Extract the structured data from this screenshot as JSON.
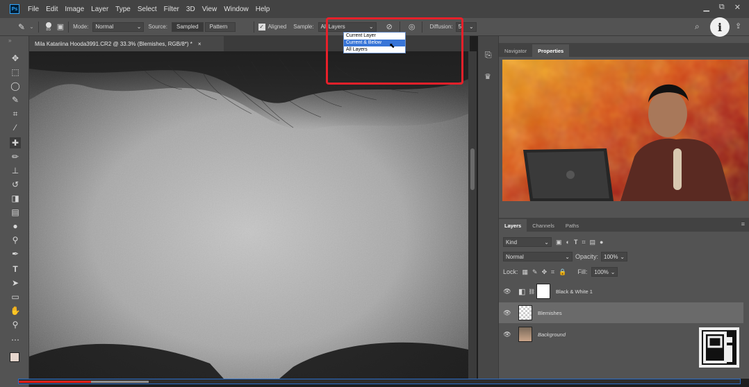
{
  "app": {
    "logo_text": "Ps",
    "menu": [
      "File",
      "Edit",
      "Image",
      "Layer",
      "Type",
      "Select",
      "Filter",
      "3D",
      "View",
      "Window",
      "Help"
    ]
  },
  "options_bar": {
    "brush_size": "85",
    "mode_label": "Mode:",
    "mode_value": "Normal",
    "source_label": "Source:",
    "source_sampled": "Sampled",
    "source_pattern": "Pattern",
    "aligned_label": "Aligned",
    "sample_label": "Sample:",
    "sample_value": "All Layers",
    "diffusion_label": "Diffusion:",
    "diffusion_value": "5"
  },
  "sample_dropdown": {
    "options": [
      "Current Layer",
      "Current & Below",
      "All Layers"
    ],
    "highlighted": "Current & Below"
  },
  "document": {
    "tab_title": "Mila Katariina Hooda3991.CR2 @ 33.3% (Blemishes, RGB/8*) *",
    "close_glyph": "×"
  },
  "top_panel": {
    "tabs": [
      "Navigator",
      "Properties"
    ],
    "active": "Properties"
  },
  "layers_panel": {
    "tabs": [
      "Layers",
      "Channels",
      "Paths"
    ],
    "active": "Layers",
    "filter_kind": "Kind",
    "blend_mode": "Normal",
    "opacity_label": "Opacity:",
    "opacity_value": "100%",
    "lock_label": "Lock:",
    "fill_label": "Fill:",
    "fill_value": "100%",
    "layers": [
      {
        "name": "Black & White 1",
        "type": "adjustment"
      },
      {
        "name": "Blemishes",
        "type": "transparent",
        "selected": true
      },
      {
        "name": "Background",
        "type": "photo"
      }
    ]
  },
  "video": {
    "progress_fraction": 0.1,
    "buffered_fraction": 0.18
  },
  "overlay": {
    "info_label": "i"
  },
  "colors": {
    "accent_highlight": "#e8202a",
    "selection_blue": "#3875d7",
    "progress_red": "#e0201a",
    "ps_blue": "#31a8ff"
  }
}
